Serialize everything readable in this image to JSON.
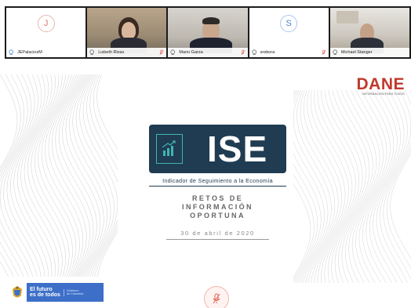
{
  "participants": [
    {
      "name": "JEPalaciosM",
      "initial": "J",
      "type": "avatar",
      "muted": false
    },
    {
      "name": "Lisbeth Rivas",
      "initial": "",
      "type": "video",
      "muted": true
    },
    {
      "name": "Mario Garza",
      "initial": "",
      "type": "video",
      "muted": true
    },
    {
      "name": "srebora",
      "initial": "S",
      "type": "avatar",
      "muted": true
    },
    {
      "name": "Michael Stanger",
      "initial": "",
      "type": "video",
      "muted": false
    }
  ],
  "slide": {
    "brand": "DANE",
    "brand_tagline": "INFORMACIÓN PARA TODOS",
    "ise_title": "ISE",
    "ise_caption": "Indicador de Seguimiento a la Economía",
    "retos_line1": "RETOS DE",
    "retos_line2": "INFORMACIÓN",
    "retos_line3": "OPORTUNA",
    "date": "30 de abril de 2020",
    "gov_main_line1": "El futuro",
    "gov_main_line2": "es de todos",
    "gov_sub_line1": "Gobierno",
    "gov_sub_line2": "de Colombia"
  },
  "colors": {
    "brand_red": "#c0392b",
    "ise_navy": "#1f3c52",
    "ise_teal": "#3fb5b0",
    "gov_blue": "#3d6fc9",
    "mute_red": "#e06a5c"
  },
  "icons": {
    "mic": "microphone-icon",
    "muted": "mic-muted-icon",
    "chart": "chart-up-icon",
    "shield": "coat-of-arms-icon"
  }
}
